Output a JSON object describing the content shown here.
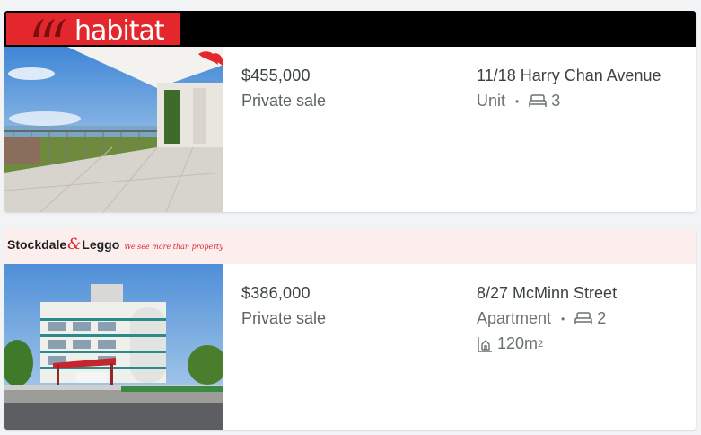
{
  "listings": [
    {
      "agency": {
        "name": "habitat",
        "bar_color": "#000000",
        "logo_color": "#e4262d"
      },
      "price": "$455,000",
      "sale_method": "Private sale",
      "address": "11/18 Harry Chan Avenue",
      "property_type": "Unit",
      "bedrooms": "3"
    },
    {
      "agency": {
        "name_part1": "Stockdale",
        "amp": "&",
        "name_part2": "Leggo",
        "tagline": "We see more than property",
        "bar_color": "#fdeeee"
      },
      "price": "$386,000",
      "sale_method": "Private sale",
      "address": "8/27 McMinn Street",
      "property_type": "Apartment",
      "bedrooms": "2",
      "land_size": "120m",
      "land_unit_sup": "2"
    }
  ],
  "icons": {
    "bed": "bed-icon",
    "land": "land-size-icon",
    "separator": "•"
  }
}
